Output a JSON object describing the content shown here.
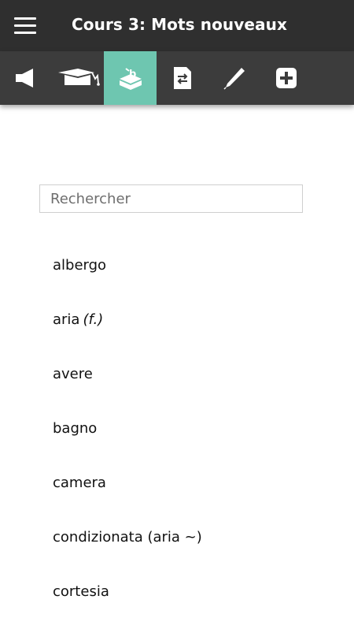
{
  "header": {
    "title": "Cours 3: Mots nouveaux",
    "menu_icon": "hamburger-menu-icon"
  },
  "toolbar": {
    "tabs": [
      {
        "icon": "speaker-icon"
      },
      {
        "icon": "graduation-cap-icon"
      },
      {
        "icon": "vocabulary-box-icon",
        "active": true
      },
      {
        "icon": "translate-document-icon"
      },
      {
        "icon": "pen-icon"
      },
      {
        "icon": "add-icon"
      }
    ],
    "active_color": "#6ec6b0"
  },
  "search": {
    "placeholder": "Rechercher",
    "value": ""
  },
  "words": [
    {
      "word": "albergo",
      "note": ""
    },
    {
      "word": "aria",
      "note": "(f.)"
    },
    {
      "word": "avere",
      "note": ""
    },
    {
      "word": "bagno",
      "note": ""
    },
    {
      "word": "camera",
      "note": ""
    },
    {
      "word": "condizionata (aria ~)",
      "note": ""
    },
    {
      "word": "cortesia",
      "note": ""
    }
  ],
  "colors": {
    "header_bg": "#2f2f2f",
    "toolbar_bg": "#3c3c3c",
    "accent": "#6ec6b0"
  }
}
